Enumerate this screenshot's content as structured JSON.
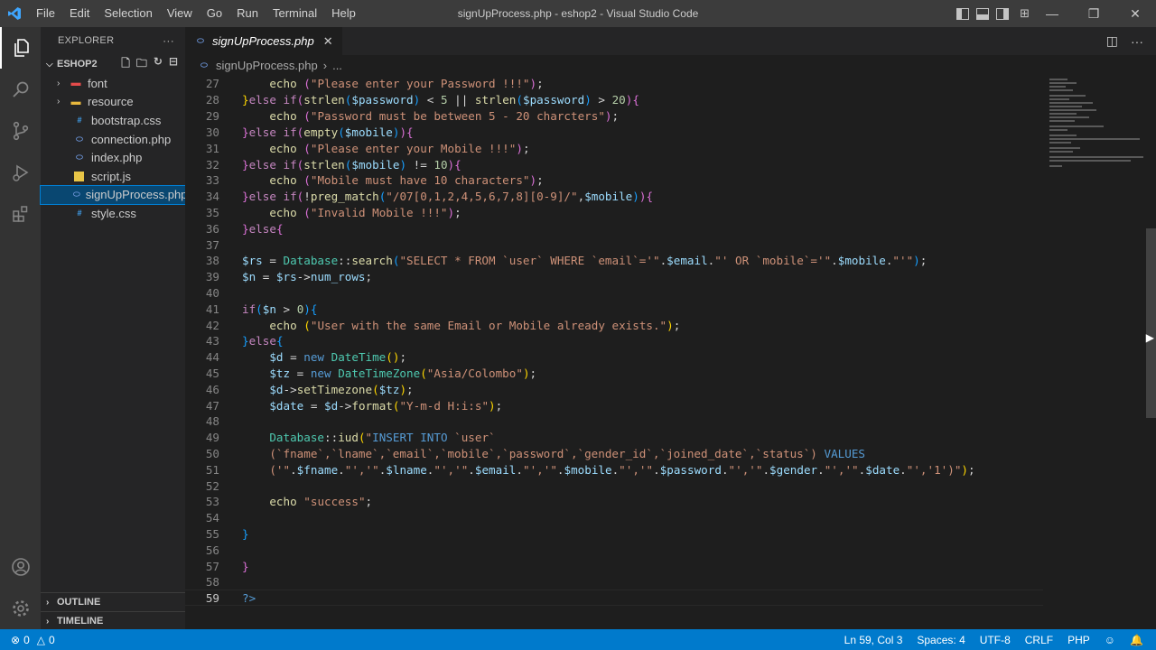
{
  "window": {
    "title": "signUpProcess.php - eshop2 - Visual Studio Code",
    "menu": [
      "File",
      "Edit",
      "Selection",
      "View",
      "Go",
      "Run",
      "Terminal",
      "Help"
    ]
  },
  "sidebar": {
    "header": "EXPLORER",
    "more": "···",
    "folder_name": "ESHOP2",
    "tree": [
      {
        "label": "font",
        "kind": "folder",
        "icon": "folder-red-icon"
      },
      {
        "label": "resource",
        "kind": "folder",
        "icon": "folder-yellow-icon"
      },
      {
        "label": "bootstrap.css",
        "kind": "file",
        "icon": "css-file-icon"
      },
      {
        "label": "connection.php",
        "kind": "file",
        "icon": "php-file-icon"
      },
      {
        "label": "index.php",
        "kind": "file",
        "icon": "php-file-icon"
      },
      {
        "label": "script.js",
        "kind": "file",
        "icon": "js-file-icon"
      },
      {
        "label": "signUpProcess.php",
        "kind": "file",
        "icon": "php-file-icon",
        "selected": true
      },
      {
        "label": "style.css",
        "kind": "file",
        "icon": "css-file-icon"
      }
    ],
    "outline": "OUTLINE",
    "timeline": "TIMELINE"
  },
  "tabs": [
    {
      "label": "signUpProcess.php",
      "active": true,
      "close": "✕"
    }
  ],
  "breadcrumb": {
    "file": "signUpProcess.php",
    "sep": "›",
    "rest": "..."
  },
  "editor": {
    "lines": [
      "27",
      "28",
      "29",
      "30",
      "31",
      "32",
      "33",
      "34",
      "35",
      "36",
      "37",
      "38",
      "39",
      "40",
      "41",
      "42",
      "43",
      "44",
      "45",
      "46",
      "47",
      "48",
      "49",
      "50",
      "51",
      "52",
      "53",
      "54",
      "55",
      "56",
      "57",
      "58",
      "59"
    ],
    "current_line": "59"
  },
  "statusbar": {
    "errors": "0",
    "warnings": "0",
    "position": "Ln 59, Col 3",
    "spaces": "Spaces: 4",
    "encoding": "UTF-8",
    "eol": "CRLF",
    "language": "PHP"
  },
  "colors": {
    "accent": "#007acc",
    "selection": "#094771"
  }
}
